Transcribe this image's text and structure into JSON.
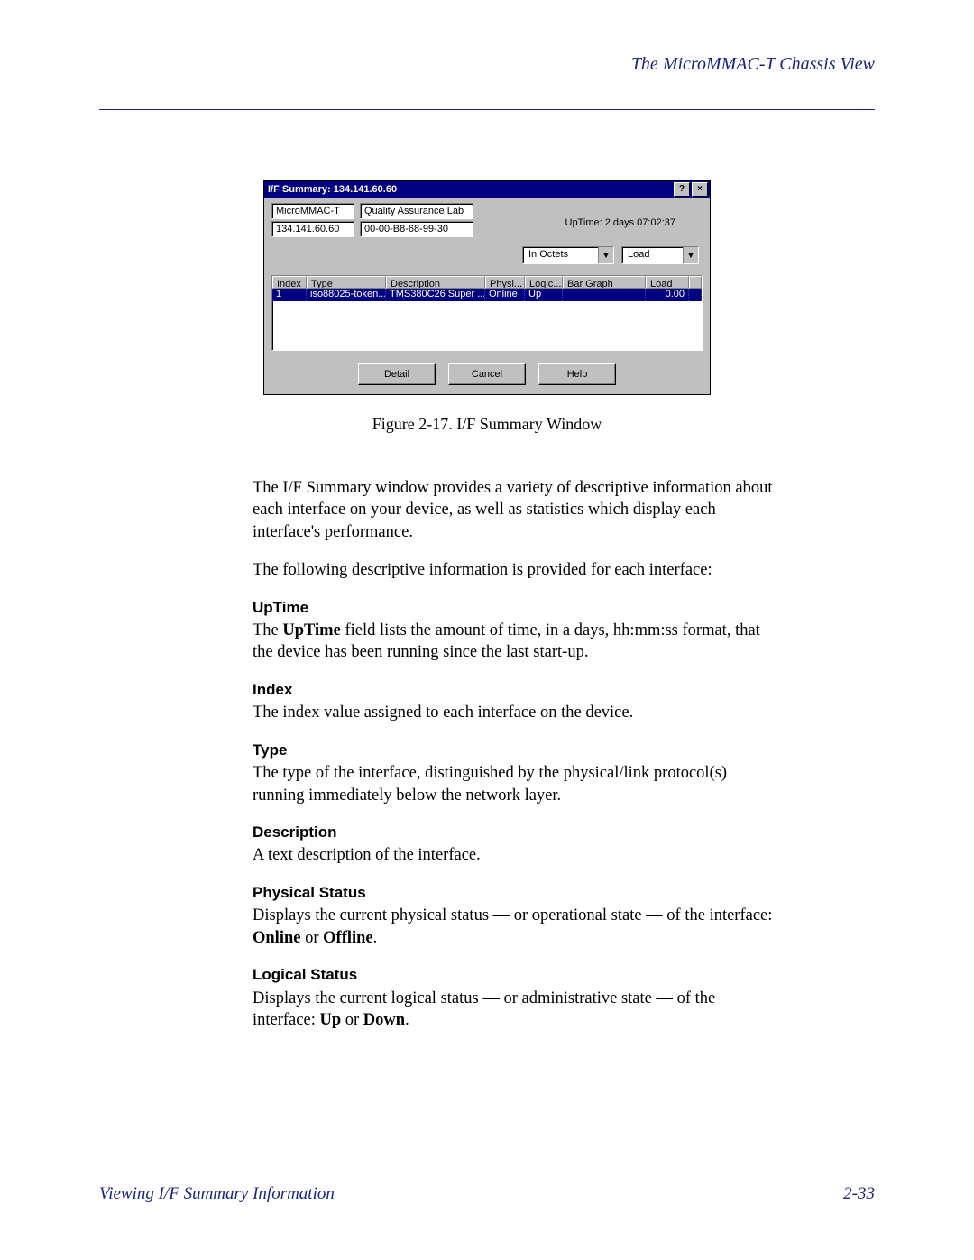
{
  "header": {
    "title": "The MicroMMAC-T Chassis View"
  },
  "window": {
    "title": "I/F Summary: 134.141.60.60",
    "help_glyph": "?",
    "close_glyph": "×",
    "device_name": "MicroMMAC-T",
    "lab": "Quality Assurance Lab",
    "ip": "134.141.60.60",
    "mac": "00-00-B8-68-99-30",
    "uptime_label": "UpTime: 2 days 07:02:37",
    "combo1": "In Octets",
    "combo2": "Load",
    "columns": {
      "index": "Index",
      "type": "Type",
      "description": "Description",
      "phys": "Physi...",
      "logic": "Logic...",
      "bar": "Bar Graph",
      "load": "Load"
    },
    "row": {
      "index": "1",
      "type": "iso88025-token...",
      "description": "TMS380C26 Super ...",
      "phys": "Online",
      "logic": "Up",
      "bar": "",
      "load": "0.00"
    },
    "buttons": {
      "detail": "Detail",
      "cancel": "Cancel",
      "help": "Help"
    }
  },
  "caption": "Figure 2-17.  I/F Summary Window",
  "para1": "The I/F Summary window provides a variety of descriptive information about each interface on your device, as well as statistics which display each interface's performance.",
  "para2": "The following descriptive information is provided for each interface:",
  "terms": {
    "uptime_h": "UpTime",
    "uptime_p1": "The ",
    "uptime_b": "UpTime",
    "uptime_p2": " field lists the amount of time, in a days, hh:mm:ss format, that the device has been running since the last start-up.",
    "index_h": "Index",
    "index_p": "The index value assigned to each interface on the device.",
    "type_h": "Type",
    "type_p": "The type of the interface, distinguished by the physical/link protocol(s) running immediately below the network layer.",
    "desc_h": "Description",
    "desc_p": "A text description of the interface.",
    "phys_h": "Physical Status",
    "phys_p1": "Displays the current physical status — or operational state — of the interface: ",
    "phys_b1": "Online",
    "phys_mid": " or ",
    "phys_b2": "Offline",
    "phys_end": ".",
    "log_h": "Logical Status",
    "log_p1": "Displays the current logical status — or administrative state — of the interface: ",
    "log_b1": "Up",
    "log_mid": " or ",
    "log_b2": "Down",
    "log_end": "."
  },
  "footer": {
    "left": "Viewing I/F Summary Information",
    "right": "2-33"
  }
}
